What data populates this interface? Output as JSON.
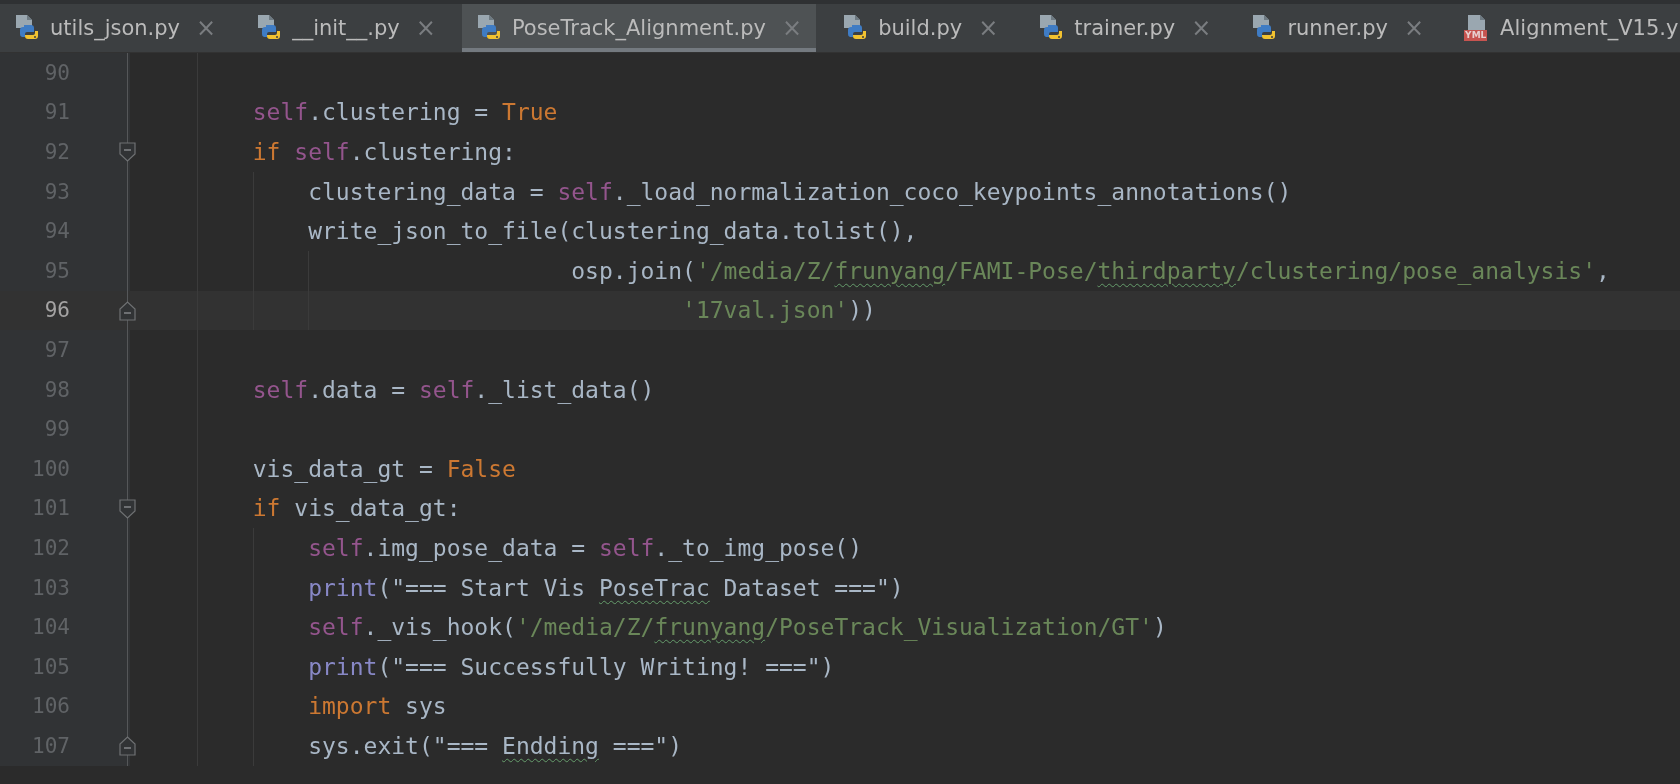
{
  "tabs": [
    {
      "label": "utils_json.py",
      "kind": "python",
      "selected": false,
      "close": "×"
    },
    {
      "label": "__init__.py",
      "kind": "python",
      "selected": false,
      "close": "×"
    },
    {
      "label": "PoseTrack_Alignment.py",
      "kind": "python",
      "selected": true,
      "close": "×"
    },
    {
      "label": "build.py",
      "kind": "python",
      "selected": false,
      "close": "×"
    },
    {
      "label": "trainer.py",
      "kind": "python",
      "selected": false,
      "close": "×"
    },
    {
      "label": "runner.py",
      "kind": "python",
      "selected": false,
      "close": "×"
    },
    {
      "label": "Alignment_V15.y",
      "kind": "yaml",
      "badge": "YML",
      "selected": false
    }
  ],
  "lines": [
    {
      "number": "90",
      "kind": "plain",
      "current": false
    },
    {
      "number": "91",
      "kind": "plain",
      "current": false,
      "tokens": [
        {
          "kind": "self",
          "text": "        self"
        },
        {
          "kind": "plain",
          "text": ".clustering = "
        },
        {
          "kind": "const",
          "text": "True"
        }
      ]
    },
    {
      "number": "92",
      "kind": "fold-start",
      "current": false,
      "tokens": [
        {
          "kind": "keyword",
          "text": "        if "
        },
        {
          "kind": "self",
          "text": "self"
        },
        {
          "kind": "plain",
          "text": ".clustering:"
        }
      ]
    },
    {
      "number": "93",
      "kind": "plain",
      "current": false,
      "tokens": [
        {
          "kind": "plain",
          "text": "            clustering_data = "
        },
        {
          "kind": "self",
          "text": "self"
        },
        {
          "kind": "plain",
          "text": "._load_normalization_coco_keypoints_annotations()"
        }
      ]
    },
    {
      "number": "94",
      "kind": "plain",
      "current": false,
      "tokens": [
        {
          "kind": "plain",
          "text": "            write_json_to_file(clustering_data.tolist(),"
        }
      ]
    },
    {
      "number": "95",
      "kind": "plain",
      "current": false,
      "tokens": [
        {
          "kind": "plain",
          "text": "                               osp.join("
        },
        {
          "kind": "string",
          "text": "'/media/Z/"
        },
        {
          "kind": "string-typo",
          "text": "frunyang"
        },
        {
          "kind": "string",
          "text": "/FAMI-Pose/"
        },
        {
          "kind": "string-typo",
          "text": "thirdparty"
        },
        {
          "kind": "string",
          "text": "/clustering/pose_analysis'"
        },
        {
          "kind": "plain",
          "text": ","
        }
      ]
    },
    {
      "number": "96",
      "kind": "fold-end",
      "current": true,
      "tokens": [
        {
          "kind": "string",
          "text": "                                       '17val.json'"
        },
        {
          "kind": "plain",
          "text": "))"
        }
      ]
    },
    {
      "number": "97",
      "kind": "plain",
      "current": false
    },
    {
      "number": "98",
      "kind": "plain",
      "current": false,
      "tokens": [
        {
          "kind": "self",
          "text": "        self"
        },
        {
          "kind": "plain",
          "text": ".data = "
        },
        {
          "kind": "self",
          "text": "self"
        },
        {
          "kind": "plain",
          "text": "._list_data()"
        }
      ]
    },
    {
      "number": "99",
      "kind": "plain",
      "current": false
    },
    {
      "number": "100",
      "kind": "plain",
      "current": false,
      "tokens": [
        {
          "kind": "plain",
          "text": "        vis_data_gt = "
        },
        {
          "kind": "const",
          "text": "False"
        }
      ]
    },
    {
      "number": "101",
      "kind": "fold-start",
      "current": false,
      "tokens": [
        {
          "kind": "keyword",
          "text": "        if "
        },
        {
          "kind": "plain",
          "text": "vis_data_gt:"
        }
      ]
    },
    {
      "number": "102",
      "kind": "plain",
      "current": false,
      "tokens": [
        {
          "kind": "self",
          "text": "            self"
        },
        {
          "kind": "plain",
          "text": ".img_pose_data = "
        },
        {
          "kind": "self",
          "text": "self"
        },
        {
          "kind": "plain",
          "text": "._to_img_pose()"
        }
      ]
    },
    {
      "number": "103",
      "kind": "plain",
      "current": false,
      "tokens": [
        {
          "kind": "builtin",
          "text": "            print"
        },
        {
          "kind": "plain",
          "text": "(\"=== Start Vis "
        },
        {
          "kind": "plain-typo",
          "text": "PoseTrac"
        },
        {
          "kind": "plain",
          "text": " Dataset ===\")"
        }
      ]
    },
    {
      "number": "104",
      "kind": "plain",
      "current": false,
      "tokens": [
        {
          "kind": "self",
          "text": "            self"
        },
        {
          "kind": "plain",
          "text": "._vis_hook("
        },
        {
          "kind": "string",
          "text": "'/media/Z/"
        },
        {
          "kind": "string-typo",
          "text": "frunyang"
        },
        {
          "kind": "string",
          "text": "/PoseTrack_Visualization/GT'"
        },
        {
          "kind": "plain",
          "text": ")"
        }
      ]
    },
    {
      "number": "105",
      "kind": "plain",
      "current": false,
      "tokens": [
        {
          "kind": "builtin",
          "text": "            print"
        },
        {
          "kind": "plain",
          "text": "(\"=== Successfully Writing! ===\")"
        }
      ]
    },
    {
      "number": "106",
      "kind": "plain",
      "current": false,
      "tokens": [
        {
          "kind": "keyword",
          "text": "            import "
        },
        {
          "kind": "plain",
          "text": "sys"
        }
      ]
    },
    {
      "number": "107",
      "kind": "fold-end",
      "current": false,
      "tokens": [
        {
          "kind": "plain",
          "text": "            sys.exit(\"=== "
        },
        {
          "kind": "plain-typo",
          "text": "Endding"
        },
        {
          "kind": "plain",
          "text": " ===\")"
        }
      ]
    }
  ]
}
